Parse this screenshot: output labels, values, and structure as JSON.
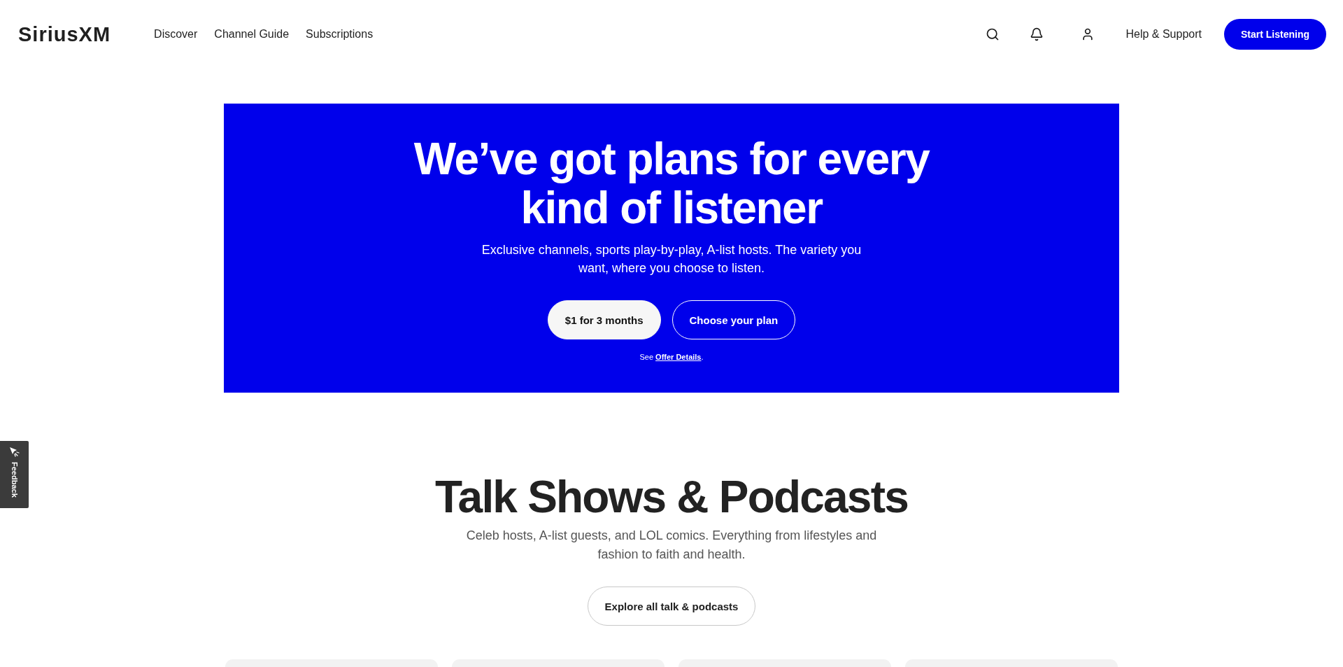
{
  "header": {
    "logo": "SiriusXM",
    "nav": [
      {
        "label": "Discover"
      },
      {
        "label": "Channel Guide"
      },
      {
        "label": "Subscriptions"
      }
    ],
    "icon_buttons": [
      {
        "kind": "search"
      },
      {
        "kind": "notifications"
      },
      {
        "kind": "account"
      }
    ],
    "help_link": "Help & Support",
    "cta": "Start Listening"
  },
  "hero": {
    "title": "We’ve got plans for every kind of listener",
    "subtitle": "Exclusive channels, sports play-by-play, A-list hosts. The variety you want, where you choose to listen.",
    "buttons": [
      {
        "label": "$1 for 3 months",
        "kind": "filled"
      },
      {
        "label": "Choose your plan",
        "kind": "outline"
      }
    ],
    "offer_note": {
      "prefix": "See",
      "link": "Offer Details",
      "suffix": "."
    }
  },
  "feedback_tab": {
    "label": "Feedback"
  },
  "section": {
    "title": "Talk Shows & Podcasts",
    "subtitle": "Celeb hosts, A-list guests, and LOL comics. Everything from lifestyles and fashion to faith and health.",
    "button": "Explore all talk & podcasts"
  }
}
